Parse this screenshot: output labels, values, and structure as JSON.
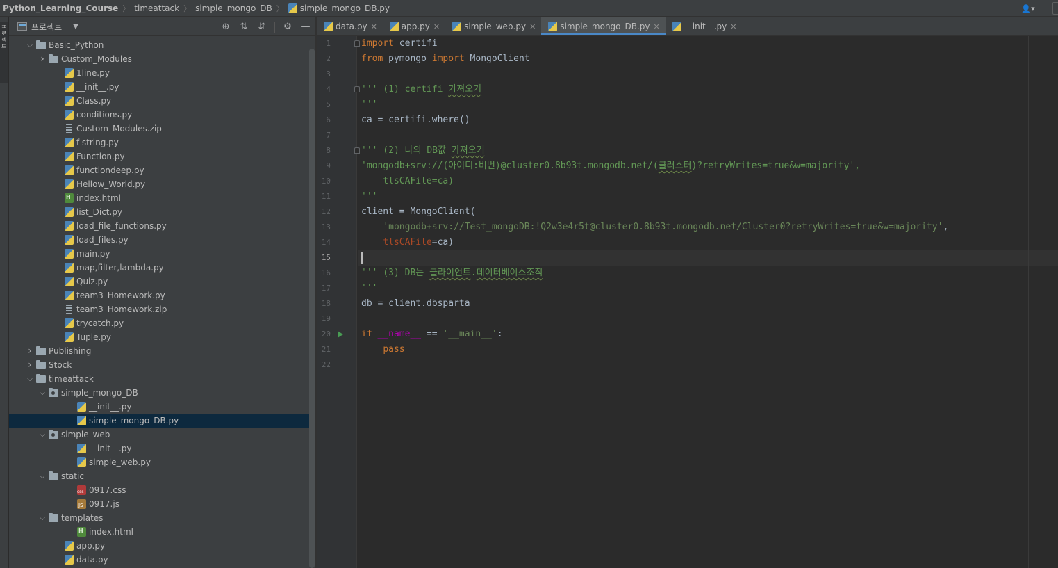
{
  "breadcrumb": [
    "Python_Learning_Course",
    "timeattack",
    "simple_mongo_DB",
    "simple_mongo_DB.py"
  ],
  "sidebar_stripe_label": "프로젝트",
  "project_panel": {
    "title": "프로젝트",
    "tree": [
      {
        "label": "Basic_Python",
        "kind": "folder",
        "depth": 1,
        "state": "expanded"
      },
      {
        "label": "Custom_Modules",
        "kind": "folder",
        "depth": 2,
        "state": "collapsed"
      },
      {
        "label": "1line.py",
        "kind": "py",
        "depth": 3
      },
      {
        "label": "__init__.py",
        "kind": "py",
        "depth": 3
      },
      {
        "label": "Class.py",
        "kind": "py",
        "depth": 3
      },
      {
        "label": "conditions.py",
        "kind": "py",
        "depth": 3
      },
      {
        "label": "Custom_Modules.zip",
        "kind": "zip",
        "depth": 3
      },
      {
        "label": "f-string.py",
        "kind": "py",
        "depth": 3
      },
      {
        "label": "Function.py",
        "kind": "py",
        "depth": 3
      },
      {
        "label": "functiondeep.py",
        "kind": "py",
        "depth": 3
      },
      {
        "label": "Hellow_World.py",
        "kind": "py",
        "depth": 3
      },
      {
        "label": "index.html",
        "kind": "html",
        "depth": 3
      },
      {
        "label": "list_Dict.py",
        "kind": "py",
        "depth": 3
      },
      {
        "label": "load_file_functions.py",
        "kind": "py",
        "depth": 3
      },
      {
        "label": "load_files.py",
        "kind": "py",
        "depth": 3
      },
      {
        "label": "main.py",
        "kind": "py",
        "depth": 3
      },
      {
        "label": "map,filter,lambda.py",
        "kind": "py",
        "depth": 3
      },
      {
        "label": "Quiz.py",
        "kind": "py",
        "depth": 3
      },
      {
        "label": "team3_Homework.py",
        "kind": "py",
        "depth": 3
      },
      {
        "label": "team3_Homework.zip",
        "kind": "zip",
        "depth": 3
      },
      {
        "label": "trycatch.py",
        "kind": "py",
        "depth": 3
      },
      {
        "label": "Tuple.py",
        "kind": "py",
        "depth": 3
      },
      {
        "label": "Publishing",
        "kind": "folder",
        "depth": 1,
        "state": "collapsed"
      },
      {
        "label": "Stock",
        "kind": "folder",
        "depth": 1,
        "state": "collapsed"
      },
      {
        "label": "timeattack",
        "kind": "folder",
        "depth": 1,
        "state": "expanded"
      },
      {
        "label": "simple_mongo_DB",
        "kind": "pkg",
        "depth": 2,
        "state": "expanded"
      },
      {
        "label": "__init__.py",
        "kind": "py",
        "depth": 4
      },
      {
        "label": "simple_mongo_DB.py",
        "kind": "py",
        "depth": 4,
        "selected": true
      },
      {
        "label": "simple_web",
        "kind": "pkg",
        "depth": 2,
        "state": "expanded"
      },
      {
        "label": "__init__.py",
        "kind": "py",
        "depth": 4
      },
      {
        "label": "simple_web.py",
        "kind": "py",
        "depth": 4
      },
      {
        "label": "static",
        "kind": "folder",
        "depth": 2,
        "state": "expanded"
      },
      {
        "label": "0917.css",
        "kind": "css",
        "depth": 4
      },
      {
        "label": "0917.js",
        "kind": "js",
        "depth": 4
      },
      {
        "label": "templates",
        "kind": "folder",
        "depth": 2,
        "state": "expanded"
      },
      {
        "label": "index.html",
        "kind": "html",
        "depth": 4
      },
      {
        "label": "app.py",
        "kind": "py",
        "depth": 3
      },
      {
        "label": "data.py",
        "kind": "py",
        "depth": 3
      }
    ]
  },
  "tabs": [
    {
      "label": "data.py",
      "active": false
    },
    {
      "label": "app.py",
      "active": false
    },
    {
      "label": "simple_web.py",
      "active": false
    },
    {
      "label": "simple_mongo_DB.py",
      "active": true
    },
    {
      "label": "__init__.py",
      "active": false
    }
  ],
  "editor": {
    "current_line": "15",
    "line_numbers": [
      "1",
      "2",
      "3",
      "4",
      "5",
      "6",
      "7",
      "8",
      "9",
      "10",
      "11",
      "12",
      "13",
      "14",
      "15",
      "16",
      "17",
      "18",
      "19",
      "20",
      "21",
      "22"
    ],
    "lines": [
      [
        [
          "kw",
          "import"
        ],
        [
          "",
          " certifi"
        ]
      ],
      [
        [
          "kw",
          "from"
        ],
        [
          "",
          " pymongo "
        ],
        [
          "kw",
          "import"
        ],
        [
          "",
          " MongoClient"
        ]
      ],
      [],
      [
        [
          "doc",
          "''' (1) certifi "
        ],
        [
          "doc squig",
          "가져오기"
        ]
      ],
      [
        [
          "doc",
          "'''"
        ]
      ],
      [
        [
          "",
          "ca = certifi.where()"
        ]
      ],
      [],
      [
        [
          "doc",
          "''' (2) 나의 DB값 "
        ],
        [
          "doc squig",
          "가져오기"
        ]
      ],
      [
        [
          "doc",
          "'mongodb+srv://(아이디:비번)@cluster0.8b93t.mongodb.net/("
        ],
        [
          "doc squig",
          "클러스터"
        ],
        [
          "doc",
          ")?retryWrites=true&w=majority',"
        ]
      ],
      [
        [
          "doc",
          "    tlsCAFile=ca)"
        ]
      ],
      [
        [
          "doc",
          "'''"
        ]
      ],
      [
        [
          "",
          "client = MongoClient("
        ]
      ],
      [
        [
          "",
          "    "
        ],
        [
          "str",
          "'mongodb+srv://Test_mongoDB:!Q2w3e4r5t@cluster0.8b93t.mongodb.net/Cluster0?retryWrites=true&w=majority'"
        ],
        [
          "",
          ","
        ]
      ],
      [
        [
          "",
          "    "
        ],
        [
          "param",
          "tlsCAFile"
        ],
        [
          "",
          "=ca)"
        ]
      ],
      [],
      [
        [
          "doc",
          "''' (3) DB는 "
        ],
        [
          "doc squig",
          "클라이언트"
        ],
        [
          "doc",
          "."
        ],
        [
          "doc squig",
          "데이터베이스조직"
        ]
      ],
      [
        [
          "doc",
          "'''"
        ]
      ],
      [
        [
          "",
          "db = client.dbsparta"
        ]
      ],
      [],
      [
        [
          "kw",
          "if"
        ],
        [
          "",
          " "
        ],
        [
          "dunder",
          "__name__"
        ],
        [
          "",
          " == "
        ],
        [
          "str",
          "'__main__'"
        ],
        [
          "",
          ":"
        ]
      ],
      [
        [
          "",
          "    "
        ],
        [
          "kw",
          "pass"
        ]
      ],
      []
    ]
  },
  "colors": {
    "keyword": "#cc7832",
    "string": "#6a8759",
    "docstring": "#629755",
    "selection": "#0d293e",
    "active_tab_underline": "#4a88c7",
    "run_marker": "#499c54"
  }
}
